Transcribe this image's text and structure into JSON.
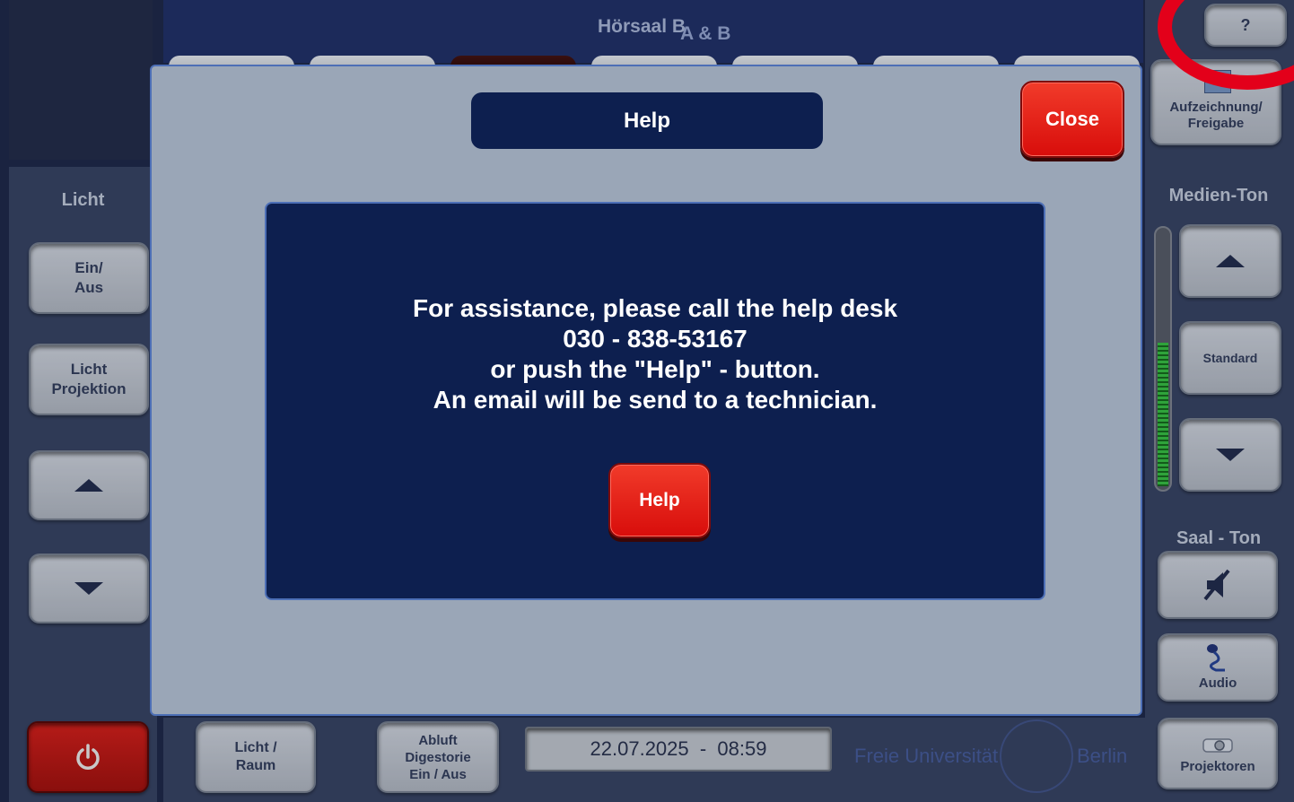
{
  "header": {
    "room_title": "Hörsaal B",
    "room_overlay": "A & B"
  },
  "top_right": {
    "question_label": "?",
    "recording_label_1": "Aufzeichnung/",
    "recording_label_2": "Freigabe"
  },
  "left": {
    "section_label": "Licht",
    "on_off_1": "Ein/",
    "on_off_2": "Aus",
    "light_proj_1": "Licht",
    "light_proj_2": "Projektion"
  },
  "right": {
    "media_label": "Medien-Ton",
    "standard_label": "Standard",
    "hall_label": "Saal - Ton",
    "audio_label": "Audio",
    "projectors_label": "Projektoren"
  },
  "bottom": {
    "light_room_1": "Licht /",
    "light_room_2": "Raum",
    "exhaust_1": "Abluft",
    "exhaust_2": "Digestorie",
    "exhaust_3": "Ein / Aus",
    "datetime": "22.07.2025  -  08:59",
    "logo_left": "Freie Universität",
    "logo_right": "Berlin"
  },
  "modal": {
    "title": "Help",
    "close_label": "Close",
    "lines": [
      "For assistance, please call the help desk",
      "030 - 838-53167",
      "or push the \"Help\" - button.",
      "An email will be send to a technician."
    ],
    "help_button_label": "Help"
  },
  "colors": {
    "accent_red": "#e0140f",
    "navy": "#0d1f4f",
    "overlay": "#9aa6b7",
    "annotation_red": "#e3001a"
  },
  "icons": [
    "power-icon",
    "mute-icon",
    "microphone-icon",
    "projector-icon",
    "arrow-up-icon",
    "arrow-down-icon",
    "recording-icon"
  ]
}
